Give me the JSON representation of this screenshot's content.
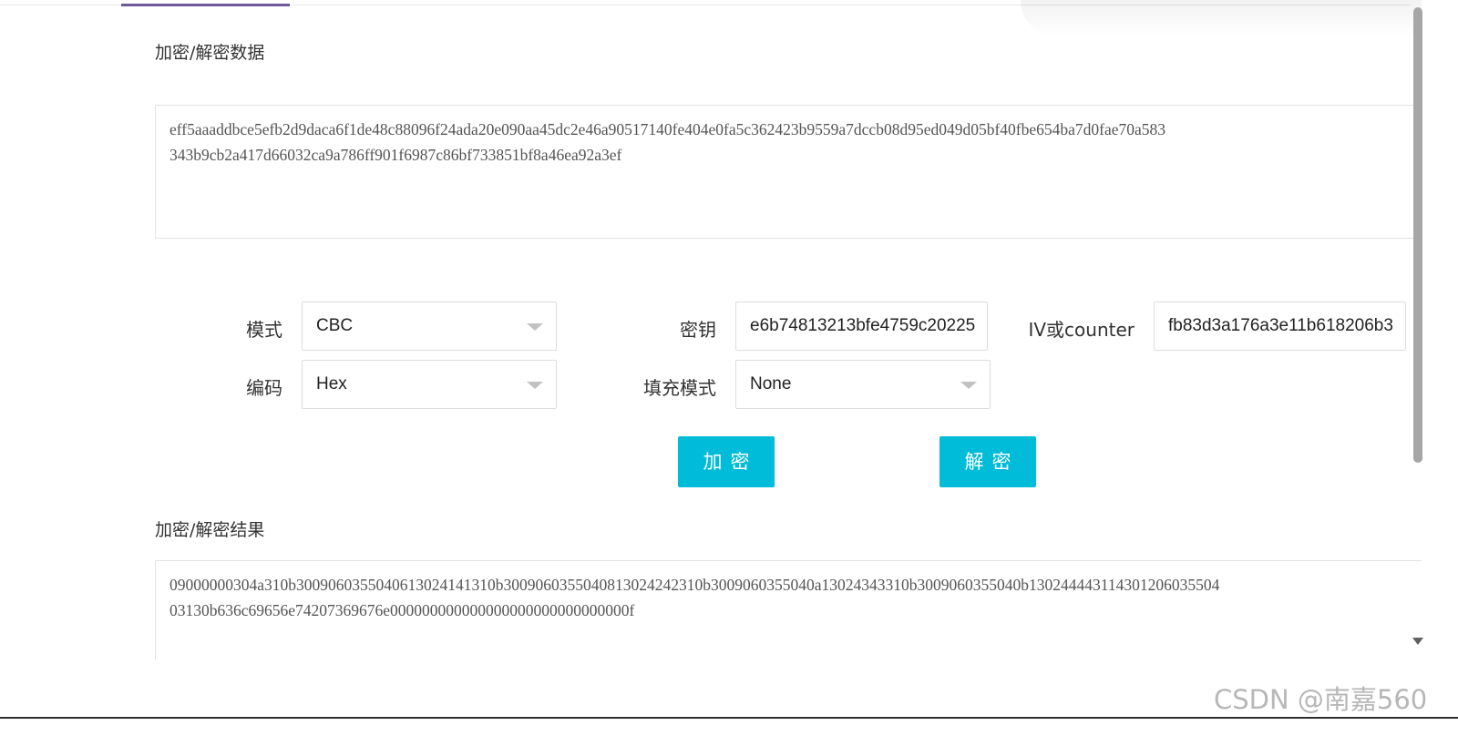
{
  "input_section": {
    "title": "加密/解密数据",
    "lines": [
      "eff5aaaddbce5efb2d9daca6f1de48c88096f24ada20e090aa45dc2e46a90517140fe404e0fa5c362423b9559a7dccb08d95ed049d05bf40fbe654ba7d0fae70a583",
      "343b9cb2a417d66032ca9a786ff901f6987c86bf733851bf8a46ea92a3ef"
    ]
  },
  "form": {
    "mode": {
      "label": "模式",
      "value": "CBC"
    },
    "key": {
      "label": "密钥",
      "value": "e6b74813213bfe4759c20225"
    },
    "iv": {
      "label": "IV或counter",
      "value": "fb83d3a176a3e11b618206b3"
    },
    "encoding": {
      "label": "编码",
      "value": "Hex"
    },
    "padding": {
      "label": "填充模式",
      "value": "None"
    }
  },
  "buttons": {
    "encrypt": "加密",
    "decrypt": "解密"
  },
  "output_section": {
    "title": "加密/解密结果",
    "lines": [
      "09000000304a310b300906035504061302414131​0b300906035504081302424231​0b3009060355040a130243433​10b3009060355040b13024444311430120603550​4",
      "03130b636c69656e74207369676e000000000000000000000000000000f"
    ]
  },
  "watermark": "CSDN @南嘉560"
}
